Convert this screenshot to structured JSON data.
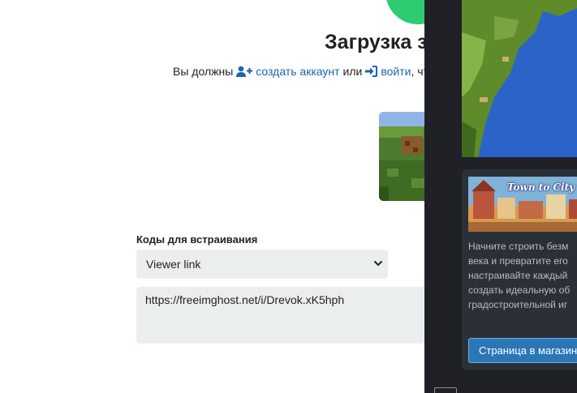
{
  "page": {
    "title": "Загрузка з",
    "login_prompt": {
      "prefix": "Вы должны",
      "create_account": "создать аккаунт",
      "or": "или",
      "login": "войти",
      "suffix": ", чт"
    },
    "embed": {
      "label": "Коды для встраивания",
      "selected_option": "Viewer link",
      "code_value": "https://freeimghost.net/i/Drevok.xK5hph"
    }
  },
  "overlay": {
    "game_logo": "Town to City",
    "description": "Начните строить безм\nвека и превратите его\nнастраивайте каждый\nсоздать идеальную об\nградостроительной иг",
    "store_button": "Страница в магазин"
  },
  "colors": {
    "link": "#1a64b4",
    "accent_green": "#2ecc71",
    "overlay_bg": "#1f2127",
    "card_bg": "#2b3038",
    "store_button": "#2a77b6"
  },
  "icons": [
    "user-plus-icon",
    "sign-in-icon",
    "chevron-down-icon"
  ]
}
